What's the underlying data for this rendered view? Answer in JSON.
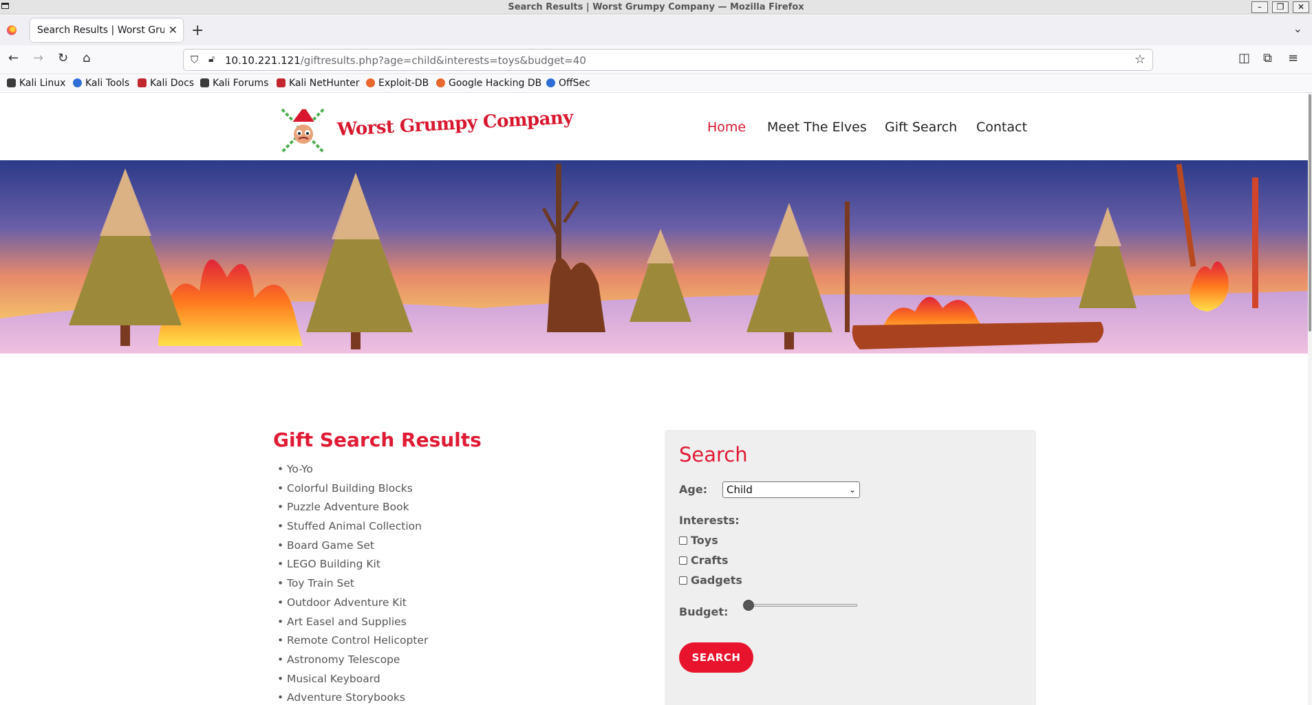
{
  "window": {
    "title": "Search Results | Worst Grumpy Company — Mozilla Firefox",
    "controls": [
      "–",
      "❐",
      "✕"
    ]
  },
  "tab": {
    "label": "Search Results | Worst Grumpy Company",
    "close": "✕",
    "new_tab": "+",
    "list_all": "⌄"
  },
  "navigation": {
    "back": "←",
    "forward": "→",
    "reload": "↻",
    "home": "⌂",
    "url_host": "10.10.221.121",
    "url_path": "/giftresults.php?age=child&interests=toys&budget=40",
    "bookmark_star": "☆",
    "pocket": "◫",
    "extensions": "⧉",
    "menu": "≡"
  },
  "bookmarks": [
    {
      "label": "Kali Linux",
      "color": "#3b3b3b"
    },
    {
      "label": "Kali Tools",
      "color": "#2f6fd6"
    },
    {
      "label": "Kali Docs",
      "color": "#c2262e"
    },
    {
      "label": "Kali Forums",
      "color": "#3b3b3b"
    },
    {
      "label": "Kali NetHunter",
      "color": "#c2262e"
    },
    {
      "label": "Exploit-DB",
      "color": "#e8652b"
    },
    {
      "label": "Google Hacking DB",
      "color": "#e8652b"
    },
    {
      "label": "OffSec",
      "color": "#2f6fd6"
    }
  ],
  "site": {
    "brand": "Worst Grumpy Company",
    "menu": [
      "Home",
      "Meet The Elves",
      "Gift Search",
      "Contact"
    ],
    "active_menu": "Home",
    "accent_color": "#e01a35"
  },
  "results": {
    "title": "Gift Search Results",
    "items": [
      "Yo-Yo",
      "Colorful Building Blocks",
      "Puzzle Adventure Book",
      "Stuffed Animal Collection",
      "Board Game Set",
      "LEGO Building Kit",
      "Toy Train Set",
      "Outdoor Adventure Kit",
      "Art Easel and Supplies",
      "Remote Control Helicopter",
      "Astronomy Telescope",
      "Musical Keyboard",
      "Adventure Storybooks"
    ]
  },
  "search_form": {
    "title": "Search",
    "age_label": "Age:",
    "age_value": "Child",
    "interests_label": "Interests:",
    "interests": [
      {
        "label": "Toys",
        "checked": false
      },
      {
        "label": "Crafts",
        "checked": false
      },
      {
        "label": "Gadgets",
        "checked": false
      }
    ],
    "budget_label": "Budget:",
    "budget_level": 0,
    "button": "SEARCH"
  }
}
